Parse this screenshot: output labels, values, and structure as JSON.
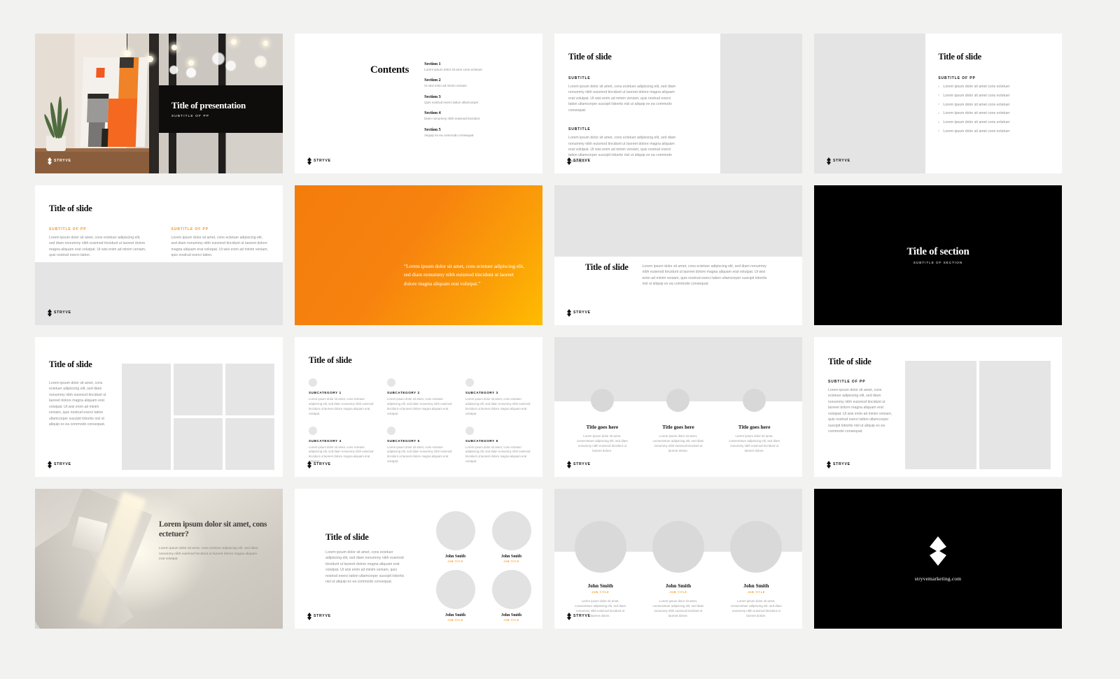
{
  "brand": {
    "name": "STRYVE",
    "accent": "#f7941d",
    "black": "#000000",
    "grey_placeholder": "#e4e4e4",
    "logo_icon": "stryve-bolt-icon"
  },
  "slides": [
    {
      "id": "title-slide",
      "title": "Title of presentation",
      "subtitle": "SUBTITLE OF PP"
    },
    {
      "id": "contents-slide",
      "heading": "Contents",
      "sections": [
        {
          "title": "Section 1",
          "desc": "Lorem ipsum dolor sit amo cons ectetuer"
        },
        {
          "title": "Section 2",
          "desc": "Ut wisi enim ad minim veniam"
        },
        {
          "title": "Section 3",
          "desc": "Quis nostrud exerci tation ullamcorper"
        },
        {
          "title": "Section 4",
          "desc": "Diam nonummy nibh euismod tincidunt"
        },
        {
          "title": "Section 5",
          "desc": "Aliquip ex ea commodo consequat"
        }
      ]
    },
    {
      "id": "two-subtitle-slide",
      "title": "Title of slide",
      "blocks": [
        {
          "eyebrow": "SUBTITLE",
          "body": "Lorem ipsum dolor sit amet, cons ectetuer adipiscing elit, sed diam nonummy nibh euismod tincidunt ut laoreet dolore magna aliquam erat volutpat. Ut wisi enim ad minim veniam, quis nostrud exerci tation ullamcorper suscipit lobortis nisl ut aliquip ex ea commodo consequat."
        },
        {
          "eyebrow": "SUBTITLE",
          "body": "Lorem ipsum dolor sit amet, cons ectetuer adipiscing elit, sed diam nonummy nibh euismod tincidunt ut laoreet dolore magna aliquam erat volutpat. Ut wisi enim ad minim veniam, quis nostrud exerci tation ullamcorper suscipit lobortis nisl ut aliquip ex ea commodo consequat."
        }
      ]
    },
    {
      "id": "bullet-list-slide",
      "title": "Title of slide",
      "eyebrow": "SUBTITLE OF PP",
      "bullets": [
        "Lorem ipsum dolor sit amet cons ectetuer",
        "Lorem ipsum dolor sit amet cons ectetuer",
        "Lorem ipsum dolor sit amet cons ectetuer",
        "Lorem ipsum dolor sit amet cons ectetuer",
        "Lorem ipsum dolor sit amet cons ectetuer",
        "Lorem ipsum dolor sit amet cons ectetuer"
      ]
    },
    {
      "id": "two-column-slide",
      "title": "Title of slide",
      "columns": [
        {
          "eyebrow": "SUBTITLE OF PP",
          "body": "Lorem ipsum dolor sit amet, cons ectetuer adipiscing elit, sed diam nonummy nibh euismod tincidunt ut laoreet dolore magna aliquam erat volutpat. Ut wisi enim ad minim veniam, quis nostrud exerci tation."
        },
        {
          "eyebrow": "SUBTITLE OF PP",
          "body": "Lorem ipsum dolor sit amet, cons ectetuer adipiscing elit, sed diam nonummy nibh euismod tincidunt ut laoreet dolore magna aliquam erat volutpat. Ut wisi enim ad minim veniam, quis nostrud exerci tation."
        }
      ]
    },
    {
      "id": "quote-slide",
      "quote": "“Lorem ipsum dolor sit amet, cons ectetuer adipiscing elit, sed diam nonummy nibh euismod tincidunt ut laoreet dolore magna aliquam erat volutpat.”",
      "background": "orange-gradient"
    },
    {
      "id": "image-band-slide",
      "title": "Title of slide",
      "body": "Lorem ipsum dolor sit amet, cons ectetuer adipiscing elit, sed diam nonummy nibh euismod tincidunt ut laoreet dolore magna aliquam erat volutpat. Ut wisi enim ad minim veniam, quis nostrud exerci tation ullamcorper suscipit lobortis nisl ut aliquip ex ea commodo consequat."
    },
    {
      "id": "section-divider-slide",
      "title": "Title of section",
      "subtitle": "SUBTITLE OF SECTION"
    },
    {
      "id": "image-grid-slide",
      "title": "Title of slide",
      "body": "Lorem ipsum dolor sit amet, cons ectetuer adipiscing elit, sed diam nonummy nibh euismod tincidunt ut laoreet dolore magna aliquam erat volutpat. Ut wisi enim ad minim veniam, quis nostrud exerci tation ullamcorper suscipit lobortis nisl ut aliquip ex ea commodo consequat."
    },
    {
      "id": "subcategories-slide",
      "title": "Title of slide",
      "categories": [
        {
          "label": "SUBCATEGORY 1",
          "body": "Lorem ipsum dolor sit amet, cons ectetuer adipiscing elit, sed diam nonummy nibh euismod tincidunt ut laoreet dolore magna aliquam erat volutpat."
        },
        {
          "label": "SUBCATEGORY 2",
          "body": "Lorem ipsum dolor sit amet, cons ectetuer adipiscing elit, sed diam nonummy nibh euismod tincidunt ut laoreet dolore magna aliquam erat volutpat."
        },
        {
          "label": "SUBCATEGORY 3",
          "body": "Lorem ipsum dolor sit amet, cons ectetuer adipiscing elit, sed diam nonummy nibh euismod tincidunt ut laoreet dolore magna aliquam erat volutpat."
        },
        {
          "label": "SUBCATEGORY 4",
          "body": "Lorem ipsum dolor sit amet, cons ectetuer adipiscing elit, sed diam nonummy nibh euismod tincidunt ut laoreet dolore magna aliquam erat volutpat."
        },
        {
          "label": "SUBCATEGORY 5",
          "body": "Lorem ipsum dolor sit amet, cons ectetuer adipiscing elit, sed diam nonummy nibh euismod tincidunt ut laoreet dolore magna aliquam erat volutpat."
        },
        {
          "label": "SUBCATEGORY 6",
          "body": "Lorem ipsum dolor sit amet, cons ectetuer adipiscing elit, sed diam nonummy nibh euismod tincidunt ut laoreet dolore magna aliquam erat volutpat."
        }
      ]
    },
    {
      "id": "three-feature-slide",
      "features": [
        {
          "title": "Title goes here",
          "body": "Lorem ipsum dolor sit amet, consectetuer adipiscing elit, sed diam nonummy nibh euismod tincidunt ut laoreet dolore."
        },
        {
          "title": "Title goes here",
          "body": "Lorem ipsum dolor sit amet, consectetuer adipiscing elit, sed diam nonummy nibh euismod tincidunt ut laoreet dolore."
        },
        {
          "title": "Title goes here",
          "body": "Lorem ipsum dolor sit amet, consectetuer adipiscing elit, sed diam nonummy nibh euismod tincidunt ut laoreet dolore."
        }
      ]
    },
    {
      "id": "two-panel-image-slide",
      "title": "Title of slide",
      "eyebrow": "SUBTITLE OF PP",
      "body": "Lorem ipsum dolor sit amet, cons ectetuer adipiscing elit, sed diam nonummy nibh euismod tincidunt ut laoreet dolore magna aliquam erat volutpat. Ut wisi enim ad minim veniam, quis nostrud exerci tation ullamcorper suscipit lobortis nisl ut aliquip ex ea commodo consequat."
    },
    {
      "id": "question-photo-slide",
      "title": "Lorem ipsum dolor sit amet, cons ectetuer?",
      "body": "Lorem ipsum dolor sit amet, cons ectetuer adipiscing elit, sed diam nonummy nibh euismod tincidunt ut laoreet dolore magna aliquam erat volutpat."
    },
    {
      "id": "four-people-slide",
      "title": "Title of slide",
      "body": "Lorem ipsum dolor sit amet, cons ectetuer adipiscing elit, sed diam nonummy nibh euismod tincidunt ut laoreet dolore magna aliquam erat volutpat. Ut wisi enim ad minim veniam, quis nostrud exerci tation ullamcorper suscipit lobortis nisl ut aliquip ex ea commodo consequat.",
      "people": [
        {
          "name": "John Smith",
          "job": "JOB TITLE"
        },
        {
          "name": "John Smith",
          "job": "JOB TITLE"
        },
        {
          "name": "John Smith",
          "job": "JOB TITLE"
        },
        {
          "name": "John Smith",
          "job": "JOB TITLE"
        }
      ]
    },
    {
      "id": "three-people-slide",
      "people": [
        {
          "name": "John Smith",
          "job": "JOB TITLE",
          "body": "Lorem ipsum dolor sit amet, consectetuer adipiscing elit, sed diam nonummy nibh euismod tincidunt ut laoreet dolore."
        },
        {
          "name": "John Smith",
          "job": "JOB TITLE",
          "body": "Lorem ipsum dolor sit amet, consectetuer adipiscing elit, sed diam nonummy nibh euismod tincidunt ut laoreet dolore."
        },
        {
          "name": "John Smith",
          "job": "JOB TITLE",
          "body": "Lorem ipsum dolor sit amet, consectetuer adipiscing elit, sed diam nonummy nibh euismod tincidunt ut laoreet dolore."
        }
      ]
    },
    {
      "id": "closing-slide",
      "url": "stryvemarketing.com"
    }
  ]
}
